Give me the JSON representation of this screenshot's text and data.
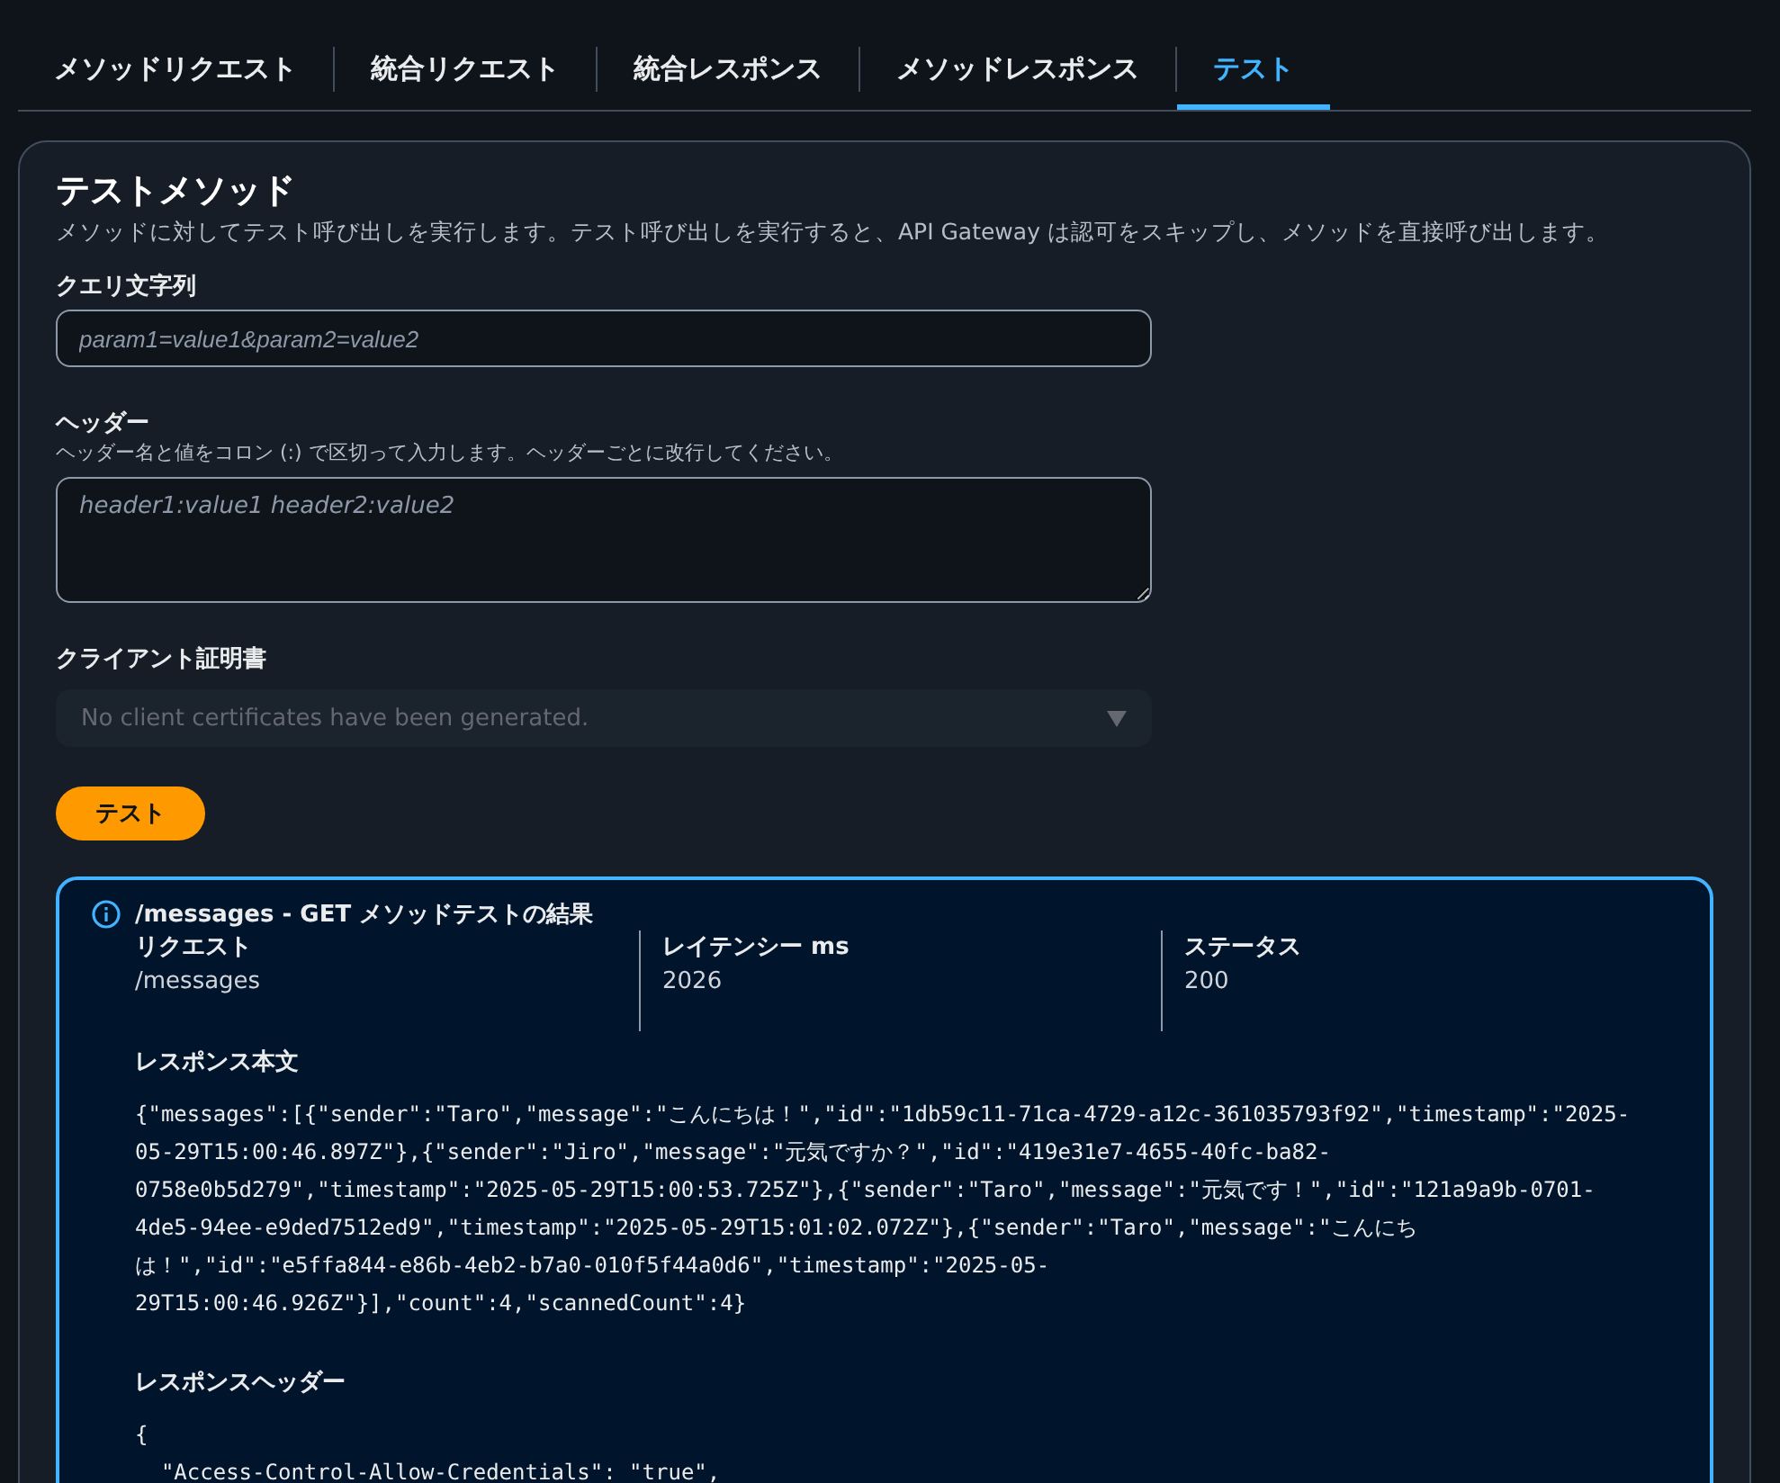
{
  "tabs": [
    {
      "label": "メソッドリクエスト",
      "selected": false
    },
    {
      "label": "統合リクエスト",
      "selected": false
    },
    {
      "label": "統合レスポンス",
      "selected": false
    },
    {
      "label": "メソッドレスポンス",
      "selected": false
    },
    {
      "label": "テスト",
      "selected": true
    }
  ],
  "panel": {
    "title": "テストメソッド",
    "description": "メソッドに対してテスト呼び出しを実行します。テスト呼び出しを実行すると、API Gateway は認可をスキップし、メソッドを直接呼び出します。",
    "query": {
      "label": "クエリ文字列",
      "placeholder": "param1=value1&param2=value2"
    },
    "headers": {
      "label": "ヘッダー",
      "hint": "ヘッダー名と値をコロン (:) で区切って入力します。ヘッダーごとに改行してください。",
      "placeholder": "header1:value1 header2:value2"
    },
    "certificate": {
      "label": "クライアント証明書",
      "placeholder": "No client certificates have been generated.",
      "disabled": true
    },
    "test_button": "テスト",
    "result": {
      "title": "/messages - GET メソッドテストの結果",
      "stats": [
        {
          "label": "リクエスト",
          "value": "/messages"
        },
        {
          "label": "レイテンシー ms",
          "value": "2026"
        },
        {
          "label": "ステータス",
          "value": "200"
        }
      ],
      "body_label": "レスポンス本文",
      "body": "{\"messages\":[{\"sender\":\"Taro\",\"message\":\"こんにちは！\",\"id\":\"1db59c11-71ca-4729-a12c-361035793f92\",\"timestamp\":\"2025-05-29T15:00:46.897Z\"},{\"sender\":\"Jiro\",\"message\":\"元気ですか？\",\"id\":\"419e31e7-4655-40fc-ba82-0758e0b5d279\",\"timestamp\":\"2025-05-29T15:00:53.725Z\"},{\"sender\":\"Taro\",\"message\":\"元気です！\",\"id\":\"121a9a9b-0701-4de5-94ee-e9ded7512ed9\",\"timestamp\":\"2025-05-29T15:01:02.072Z\"},{\"sender\":\"Taro\",\"message\":\"こんにちは！\",\"id\":\"e5ffa844-e86b-4eb2-b7a0-010f5f44a0d6\",\"timestamp\":\"2025-05-29T15:00:46.926Z\"}],\"count\":4,\"scannedCount\":4}",
      "headers_label": "レスポンスヘッダー",
      "header_lines": [
        "{",
        "  \"Access-Control-Allow-Credentials\": \"true\","
      ]
    }
  }
}
